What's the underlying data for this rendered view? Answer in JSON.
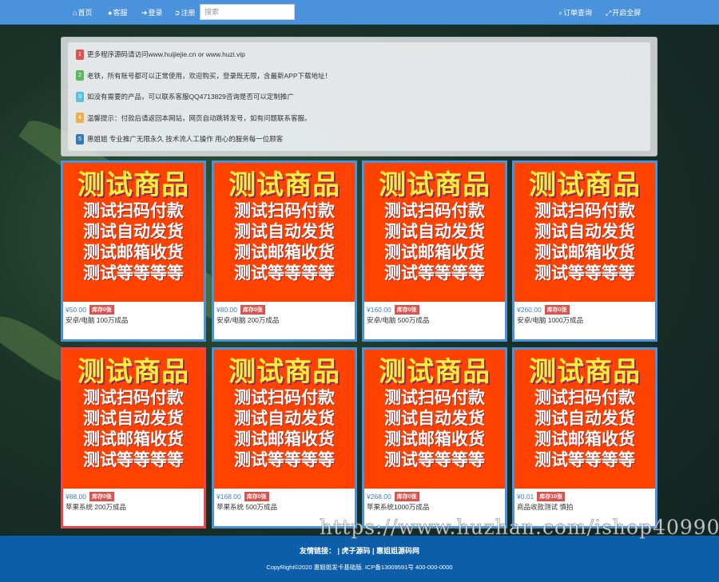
{
  "nav": {
    "home": "首页",
    "service": "客服",
    "login": "登录",
    "register": "注册",
    "search_placeholder": "搜索",
    "orders": "订单查询",
    "fullscreen": "开启全屏"
  },
  "notices": [
    {
      "num": "1",
      "text": "更多程序源码请访问www.huijiejie.cn  or  www.huzi.vip",
      "color": "#d9534f"
    },
    {
      "num": "2",
      "text": "老铁，所有账号都可以正常使用，欢迎购买，登录既无限，含最新APP下载地址！",
      "color": "#5cb85c"
    },
    {
      "num": "3",
      "text": "如没有需要的产品，可以联系客服QQ4713829咨询是否可以定制推广",
      "color": "#5bc0de"
    },
    {
      "num": "4",
      "text": "温馨提示：付款后请返回本网站，网页自动跳转发号，如有问题联系客服。",
      "color": "#f0ad4e"
    },
    {
      "num": "5",
      "text": "惠姐姐 专业推广无限永久 技术流人工操作 用心的服务每一位顾客",
      "color": "#337ab7"
    }
  ],
  "product_image": {
    "title": "测试商品",
    "lines": [
      "测试扫码付款",
      "测试自动发货",
      "测试邮箱收货",
      "测试等等等等"
    ]
  },
  "products": [
    {
      "price": "¥50.00",
      "stock": "库存0张",
      "name": "安卓/电脑 100万成品"
    },
    {
      "price": "¥80.00",
      "stock": "库存0张",
      "name": "安卓/电脑 200万成品"
    },
    {
      "price": "¥160.00",
      "stock": "库存0张",
      "name": "安卓/电脑 500万成品"
    },
    {
      "price": "¥260.00",
      "stock": "库存0张",
      "name": "安卓/电脑 1000万成品"
    },
    {
      "price": "¥88.00",
      "stock": "库存0张",
      "name": "苹果系统 200万成品"
    },
    {
      "price": "¥168.00",
      "stock": "库存0张",
      "name": "苹果系统 500万成品"
    },
    {
      "price": "¥268.00",
      "stock": "库存0张",
      "name": "苹果系统1000万成品"
    },
    {
      "price": "¥0.01",
      "stock": "库存10张",
      "name": "商品收款测试 慎拍"
    }
  ],
  "footer": {
    "links_label": "友情链接：",
    "link1": "虎子源码",
    "link2": "惠姐姐源码网",
    "copyright": "CopyRight©2020 惠姐姐发卡基础版.   ICP备13009591号   400-000-0000"
  },
  "watermark": "https://www.huzhan.com/ishop40990"
}
